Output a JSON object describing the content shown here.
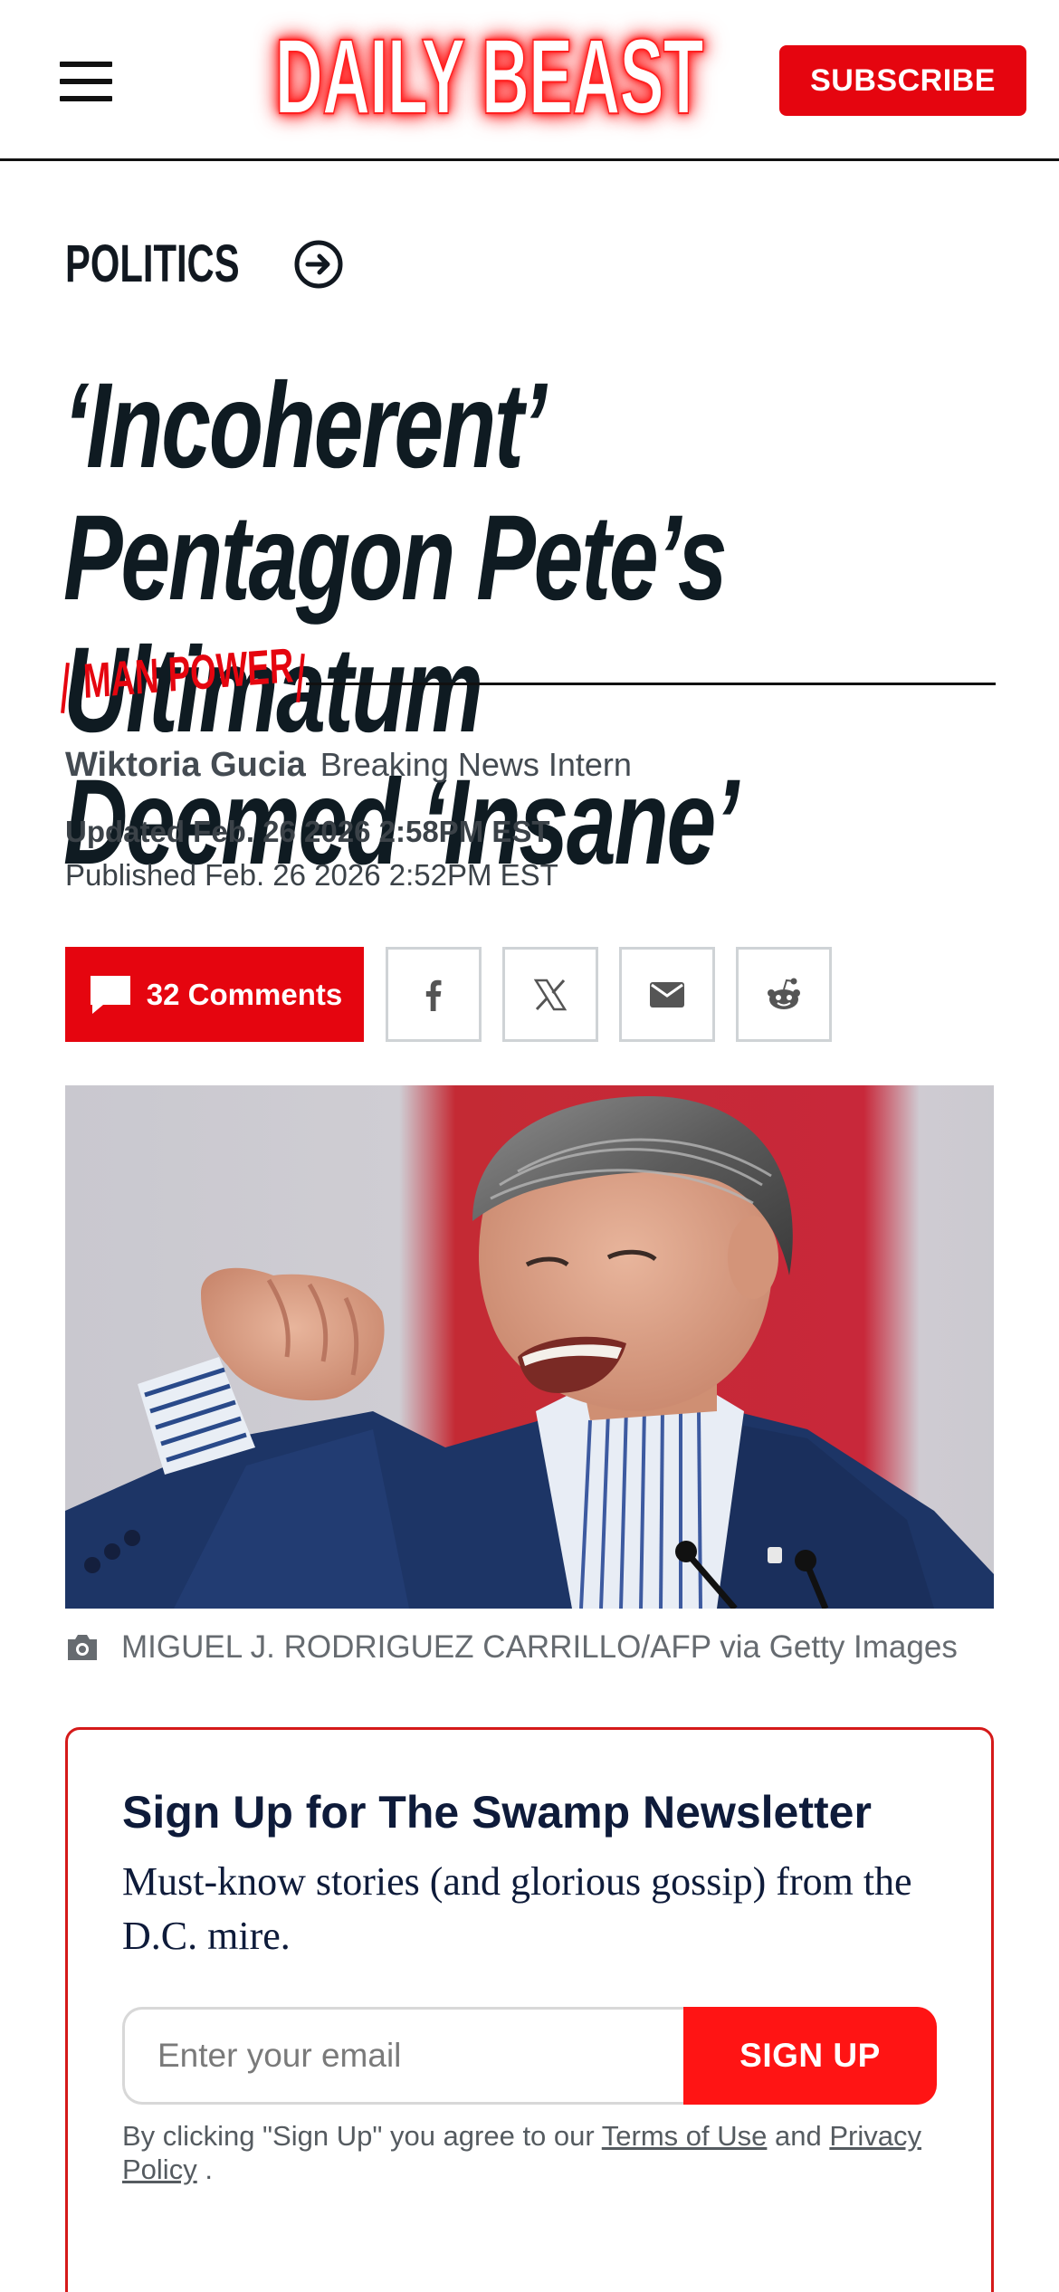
{
  "header": {
    "menu_icon": "hamburger-menu-icon",
    "logo_text": "DAILY BEAST",
    "subscribe_label": "SUBSCRIBE"
  },
  "article": {
    "section": "POLITICS",
    "section_icon": "arrow-circle-right-icon",
    "headline": "‘Incoherent’ Pentagon Pete’s Ultimatum Deemed ‘Insane’",
    "rubric": "MAN POWER",
    "author": "Wiktoria Gucia",
    "author_role": "Breaking News Intern",
    "updated": "Updated Feb. 26 2026 2:58PM EST",
    "published": "Published Feb. 26 2026 2:52PM EST",
    "comments_label": "32 Comments",
    "share": {
      "facebook": "facebook-icon",
      "x": "x-icon",
      "email": "email-icon",
      "reddit": "reddit-icon"
    },
    "photo_credit": "MIGUEL J. RODRIGUEZ CARRILLO/AFP via Getty Images"
  },
  "newsletter": {
    "title": "Sign Up for The Swamp Newsletter",
    "description": "Must-know stories (and glorious gossip) from the D.C. mire.",
    "email_placeholder": "Enter your email",
    "button_label": "SIGN UP",
    "legal_prefix": "By clicking \"Sign Up\" you agree to our ",
    "terms_label": "Terms of Use",
    "legal_and": " and ",
    "privacy_label": "Privacy Policy",
    "legal_suffix": " ."
  },
  "colors": {
    "brand_red": "#e5050f",
    "text_dark": "#0f1b22",
    "newsletter_navy": "#0e1b3a"
  }
}
